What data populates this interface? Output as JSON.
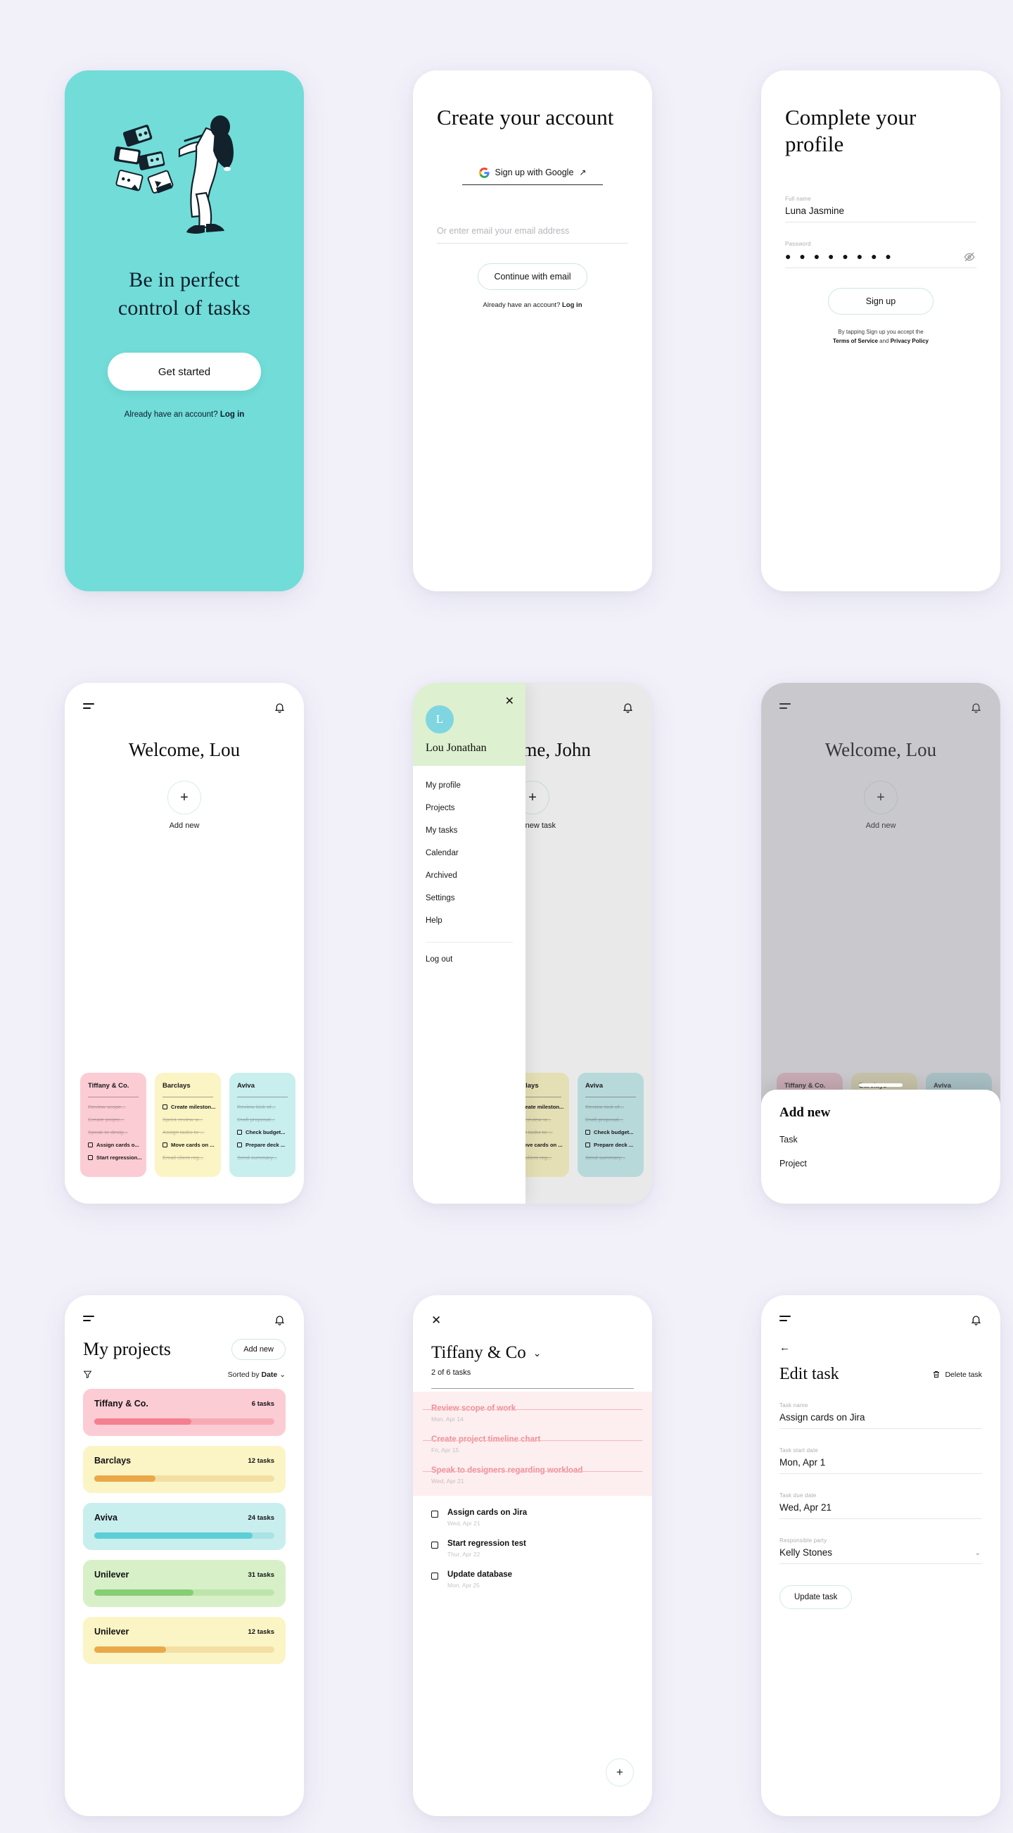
{
  "theme": {
    "page_bg": "#f2f1fa",
    "teal": "#71dcd8",
    "mint_border": "#cfe6e3",
    "drawer_green": "#ddf0cf",
    "avatar_blue": "#7fd6e0"
  },
  "screen1": {
    "title": "Be in perfect control of tasks",
    "cta": "Get started",
    "foot_text": "Already have an account? ",
    "foot_link": "Log in"
  },
  "screen2": {
    "title": "Create your account",
    "google_label": "Sign up with Google",
    "google_arrow": "↗",
    "email_placeholder": "Or enter email your email address",
    "continue_label": "Continue with email",
    "foot_text": "Already have an account?  ",
    "foot_link": "Log in"
  },
  "screen3": {
    "title": "Complete your profile",
    "fields": [
      {
        "label": "Full name",
        "value": "Luna Jasmine"
      },
      {
        "label": "Password",
        "value": "● ● ● ● ● ● ● ●"
      }
    ],
    "signup_label": "Sign up",
    "legal_line1": "By tapping Sign up you accept the",
    "legal_tos": "Terms of Service",
    "legal_and": " and ",
    "legal_pp": "Privacy Policy"
  },
  "screen4": {
    "greeting": "Welcome, Lou",
    "add_new": "Add new",
    "cards": [
      {
        "name": "Tiffany & Co.",
        "bg": "#fcccd4",
        "tasks": [
          {
            "text": "Review scope...",
            "done": true
          },
          {
            "text": "Create projec...",
            "done": true
          },
          {
            "text": "Speak to desig...",
            "done": true
          },
          {
            "text": "Assign cards o...",
            "done": false
          },
          {
            "text": "Start regression...",
            "done": false
          }
        ]
      },
      {
        "name": "Barclays",
        "bg": "#fbf4c4",
        "tasks": [
          {
            "text": "Create mileston...",
            "done": false
          },
          {
            "text": "Sprint review w...",
            "done": true
          },
          {
            "text": "Assign tasks to ...",
            "done": true
          },
          {
            "text": "Move cards on ...",
            "done": false
          },
          {
            "text": "Email client reg...",
            "done": true
          }
        ]
      },
      {
        "name": "Aviva",
        "bg": "#c9eeee",
        "tasks": [
          {
            "text": "Review kick of...",
            "done": true
          },
          {
            "text": "Draft proposal...",
            "done": true
          },
          {
            "text": "Check budget...",
            "done": false
          },
          {
            "text": "Prepare deck ...",
            "done": false
          },
          {
            "text": "Send summary...",
            "done": true
          }
        ]
      }
    ]
  },
  "screen5": {
    "greeting": "Welcome, John",
    "add_new": "Add new task",
    "user_initial": "L",
    "user_name": "Lou Jonathan",
    "menu": [
      "My profile",
      "Projects",
      "My tasks",
      "Calendar",
      "Archived",
      "Settings",
      "Help"
    ],
    "logout": "Log out"
  },
  "screen6": {
    "greeting": "Welcome, Lou",
    "add_new": "Add new",
    "sheet_title": "Add new",
    "sheet_items": [
      "Task",
      "Project"
    ]
  },
  "screen7": {
    "title": "My projects",
    "add_new": "Add new",
    "sorted_prefix": "Sorted by ",
    "sorted_value": "Date",
    "projects": [
      {
        "name": "Tiffany & Co.",
        "tasks": "6 tasks",
        "bg": "#fcccd4",
        "fill": "#f4808f",
        "track": "#f8aab4",
        "pct": 54
      },
      {
        "name": "Barclays",
        "tasks": "12 tasks",
        "bg": "#fbf4c4",
        "fill": "#eaa84a",
        "track": "#f3dfa4",
        "pct": 34
      },
      {
        "name": "Aviva",
        "tasks": "24 tasks",
        "bg": "#c9eeee",
        "fill": "#5ccfd6",
        "track": "#a8e3e6",
        "pct": 88
      },
      {
        "name": "Unilever",
        "tasks": "31 tasks",
        "bg": "#d8f0c8",
        "fill": "#86ce74",
        "track": "#bde5ab",
        "pct": 55
      },
      {
        "name": "Unilever",
        "tasks": "12 tasks",
        "bg": "#fbf4c4",
        "fill": "#eaa84a",
        "track": "#f3dfa4",
        "pct": 40
      }
    ]
  },
  "screen8": {
    "project_name": "Tiffany & Co",
    "progress": "2 of 6 tasks",
    "done_tasks": [
      {
        "name": "Review scope of work",
        "date": "Mon, Apr 14"
      },
      {
        "name": "Create project timeline chart",
        "date": "Fri, Apr 15"
      },
      {
        "name": "Speak to designers regarding workload",
        "date": "Wed, Apr 21"
      }
    ],
    "open_tasks": [
      {
        "name": "Assign cards on Jira",
        "date": "Wed, Apr 21"
      },
      {
        "name": "Start regression test",
        "date": "Thur, Apr 22"
      },
      {
        "name": "Update database",
        "date": "Mon, Apr 25"
      }
    ]
  },
  "screen9": {
    "title": "Edit task",
    "delete_label": "Delete task",
    "fields": [
      {
        "label": "Task name",
        "value": "Assign cards on Jira",
        "chevron": false
      },
      {
        "label": "Task start date",
        "value": "Mon, Apr 1",
        "chevron": false
      },
      {
        "label": "Task due date",
        "value": "Wed, Apr 21",
        "chevron": false
      },
      {
        "label": "Responsible party",
        "value": "Kelly Stones",
        "chevron": true
      }
    ],
    "update_label": "Update task"
  }
}
